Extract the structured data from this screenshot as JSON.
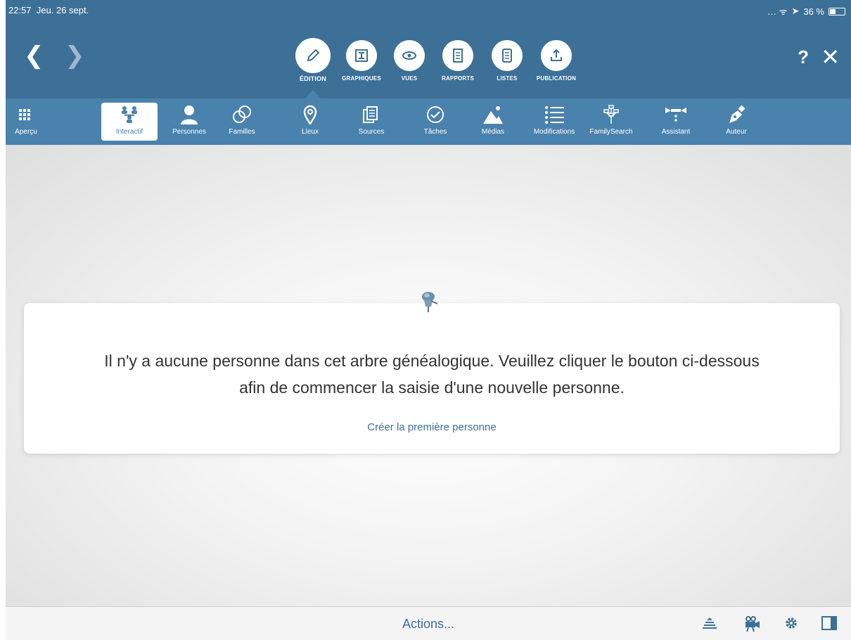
{
  "status_bar": {
    "time": "22:57",
    "date": "Jeu. 26 sept.",
    "battery": "36 %"
  },
  "nav": {
    "back_icon": "chevron-left-icon",
    "forward_icon": "chevron-right-icon",
    "help_label": "?",
    "close_icon": "close-icon"
  },
  "modes": [
    {
      "label": "ÉDITION",
      "icon": "pencil-icon",
      "active": true
    },
    {
      "label": "GRAPHIQUES",
      "icon": "tree-chart-icon"
    },
    {
      "label": "VUES",
      "icon": "eye-icon"
    },
    {
      "label": "RAPPORTS",
      "icon": "report-icon"
    },
    {
      "label": "LISTES",
      "icon": "list-icon"
    },
    {
      "label": "PUBLICATION",
      "icon": "upload-icon"
    }
  ],
  "toolbar": [
    {
      "label": "Aperçu",
      "icon": "grid-icon"
    },
    {
      "label": "Interactif",
      "icon": "family-tree-icon",
      "active": true
    },
    {
      "label": "Personnes",
      "icon": "person-icon"
    },
    {
      "label": "Familles",
      "icon": "rings-icon"
    },
    {
      "label": "Lieux",
      "icon": "map-pin-icon"
    },
    {
      "label": "Sources",
      "icon": "documents-icon"
    },
    {
      "label": "Tâches",
      "icon": "checkmark-icon"
    },
    {
      "label": "Médias",
      "icon": "mountain-icon"
    },
    {
      "label": "Modifications",
      "icon": "list-bullets-icon"
    },
    {
      "label": "FamilySearch",
      "icon": "familysearch-tree-icon"
    },
    {
      "label": "Assistant",
      "icon": "wand-icon"
    },
    {
      "label": "Auteur",
      "icon": "fountain-pen-icon"
    }
  ],
  "card": {
    "message_line1": "Il n'y a aucune personne dans cet arbre généalogique. Veuillez cliquer le bouton ci-dessous",
    "message_line2": "afin de commencer la saisie d'une nouvelle personne.",
    "create_label": "Créer la première personne"
  },
  "bottom_bar": {
    "actions_label": "Actions...",
    "icons": [
      "stack-icon",
      "video-camera-icon",
      "gear-icon",
      "sidebar-icon"
    ]
  },
  "colors": {
    "header": "#3d7097",
    "toolbar": "#4a82ae",
    "link": "#3d7097"
  }
}
